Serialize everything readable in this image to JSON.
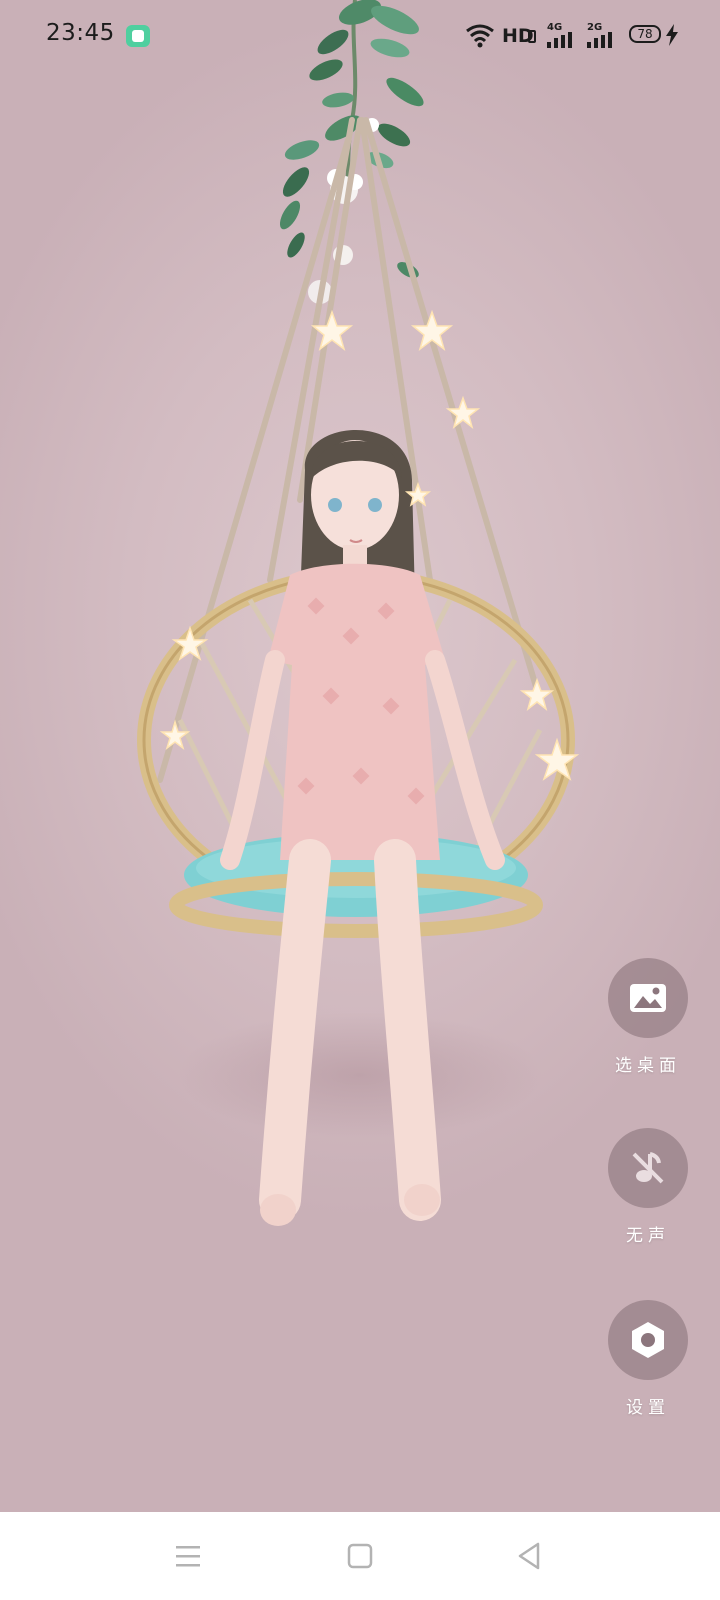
{
  "status_bar": {
    "time": "23:45",
    "app_notification_icon": "green-app-icon",
    "icons": [
      "wifi-icon",
      "hd-volte-icon",
      "signal-4g-icon",
      "signal-2g-icon",
      "battery-icon",
      "charging-bolt-icon"
    ],
    "hd_label": "HD",
    "network_1": "4G",
    "network_2": "2G",
    "battery_level": "78"
  },
  "wallpaper": {
    "description_icon": "anime-girl-on-hanging-swing-chair",
    "background_color": "#d3bcc2",
    "cushion_color": "#7fd0d3"
  },
  "actions": [
    {
      "label": "选桌面",
      "icon": "image-icon"
    },
    {
      "label": "无声",
      "icon": "mute-music-icon"
    },
    {
      "label": "设置",
      "icon": "settings-hexagon-icon"
    }
  ],
  "nav_bar": {
    "icons": [
      "menu-icon",
      "home-square-icon",
      "back-triangle-icon"
    ]
  }
}
